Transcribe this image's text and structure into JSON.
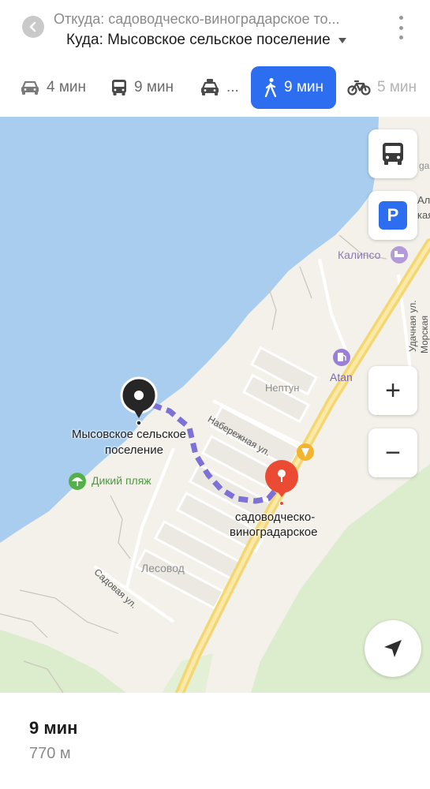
{
  "header": {
    "from_text": "Откуда: садоводческо-виноградарское то...",
    "to_text": "Куда: Мысовское сельское поселение"
  },
  "modes": [
    {
      "name": "car",
      "icon": "car-icon",
      "label": "4 мин"
    },
    {
      "name": "bus",
      "icon": "bus-icon",
      "label": "9 мин"
    },
    {
      "name": "taxi",
      "icon": "taxi-icon",
      "label": "..."
    },
    {
      "name": "walk",
      "icon": "walk-icon",
      "label": "9 мин",
      "selected": true
    },
    {
      "name": "bike",
      "icon": "bike-icon",
      "label": "5 мин"
    }
  ],
  "map": {
    "places": {
      "start_line1": "Мысовское сельское",
      "start_line2": "поселение",
      "end_line1": "садоводческо-",
      "end_line2": "виноградарское",
      "beach": "Дикий пляж",
      "hotel": "Калипсо",
      "gas": "Atan",
      "neptun": "Нептун",
      "lesovod": "Лесовод",
      "street_naberezhnaya": "Набережная ул.",
      "street_sadovaya": "Садовая ул.",
      "street_udachnaya": "Удачная ул.",
      "street_morskaya": "Морская",
      "edge_top": "ga",
      "edge_ale": "Але",
      "edge_kaya": "кая"
    },
    "parking_label": "P",
    "zoom_in_label": "+",
    "zoom_out_label": "−",
    "colors": {
      "water": "#a8cdee",
      "land": "#f3f1ea",
      "forest": "#dbedcd",
      "road": "#f4d775",
      "route": "#7d70d6",
      "end_pin": "#ec4b33",
      "start_pin": "#262626",
      "accent": "#2d6ef0"
    }
  },
  "summary": {
    "duration": "9 мин",
    "distance": "770 м"
  }
}
